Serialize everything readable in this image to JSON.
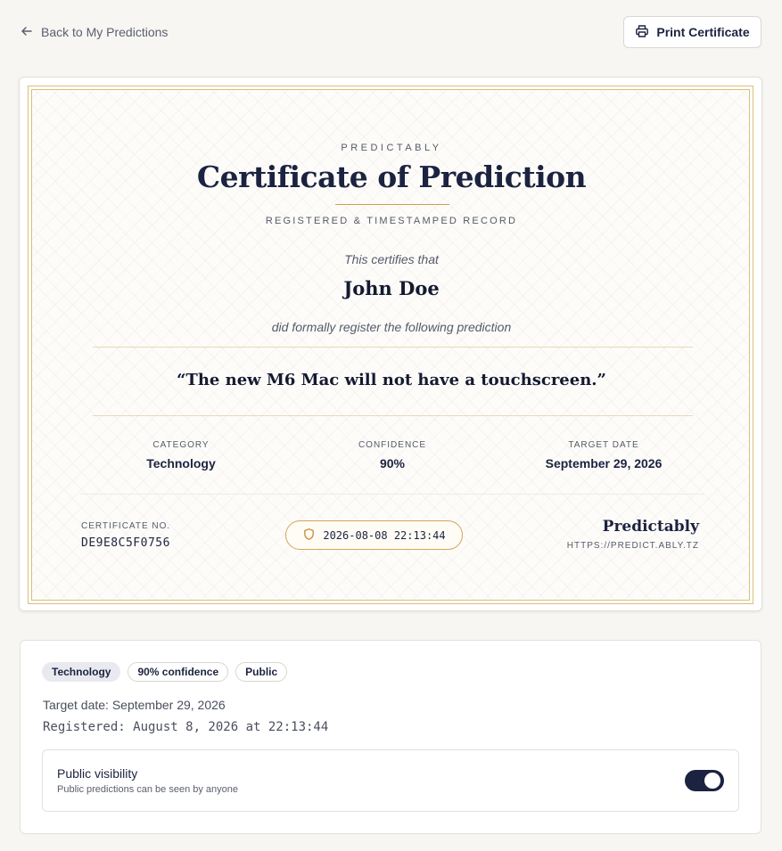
{
  "nav": {
    "back_label": "Back to My Predictions",
    "print_label": "Print Certificate"
  },
  "certificate": {
    "brand_small": "PREDICTABLY",
    "title": "Certificate of Prediction",
    "subtitle": "REGISTERED & TIMESTAMPED RECORD",
    "certifies_text": "This certifies that",
    "holder_name": "John Doe",
    "formally_text": "did formally register the following prediction",
    "prediction": "“The new M6 Mac will not have a touchscreen.”",
    "category_label": "CATEGORY",
    "category_value": "Technology",
    "confidence_label": "CONFIDENCE",
    "confidence_value": "90%",
    "target_label": "TARGET DATE",
    "target_value": "September 29, 2026",
    "cert_no_label": "CERTIFICATE NO.",
    "cert_no": "DE9E8C5F0756",
    "timestamp": "2026-08-08 22:13:44",
    "brand_big": "Predictably",
    "brand_url": "HTTPS://PREDICT.ABLY.TZ"
  },
  "details": {
    "tags": [
      "Technology",
      "90% confidence",
      "Public"
    ],
    "target_line": "Target date: September 29, 2026",
    "registered_line": "Registered: August 8, 2026 at 22:13:44",
    "visibility_title": "Public visibility",
    "visibility_desc": "Public predictions can be seen by anyone",
    "visibility_on": true
  },
  "colors": {
    "navy": "#1c2340",
    "gold": "#c9a24a",
    "background": "#f7f6f3"
  },
  "icons": {
    "back": "arrow-left-icon",
    "print": "printer-icon",
    "stamp": "shield-icon"
  }
}
